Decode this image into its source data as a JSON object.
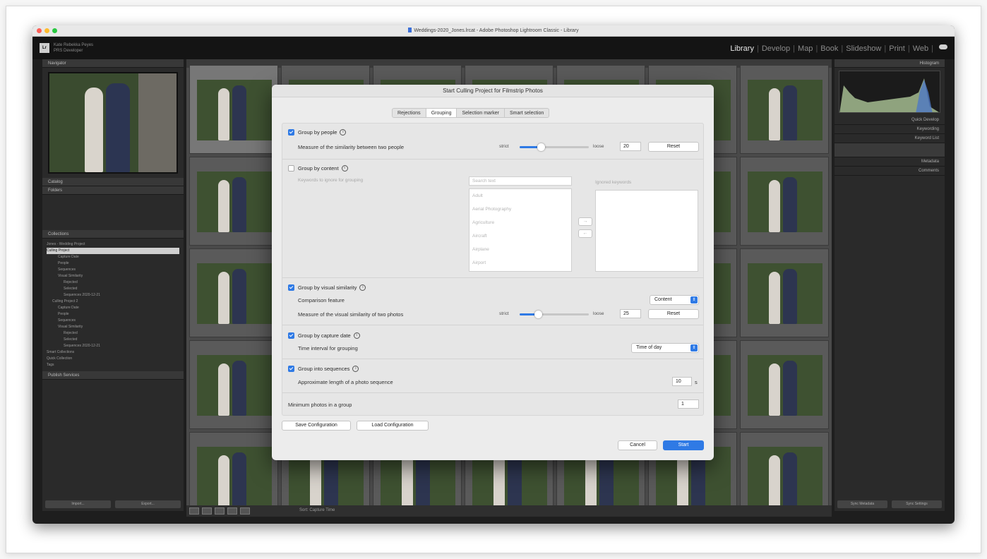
{
  "window": {
    "title": "Weddings-2020_Jones.lrcat - Adobe Photoshop Lightroom Classic - Library"
  },
  "identity": {
    "logo": "Lr",
    "line1": "Kate Rebekka Peyes",
    "line2": "PRS Developer"
  },
  "modules": [
    "Library",
    "Develop",
    "Map",
    "Book",
    "Slideshow",
    "Print",
    "Web"
  ],
  "active_module": "Library",
  "left_panel": {
    "navigator": "Navigator",
    "catalog": "Catalog",
    "folders": "Folders",
    "collections": "Collections",
    "publish": "Publish Services",
    "tree": [
      "Jones - Wedding Project",
      "Culling Project",
      "Capture Date",
      "People",
      "Sequences",
      "Visual Similarity",
      "Rejected",
      "Selected",
      "Sequences 2020-12-21",
      "Culling Project 2",
      "Capture Date",
      "People",
      "Sequences",
      "Visual Similarity",
      "Rejected",
      "Selected",
      "Sequences 2020-12-21",
      "Smart Collections",
      "Quick Collection",
      "Tags"
    ],
    "import_btn": "Import...",
    "export_btn": "Export..."
  },
  "right_panel": {
    "histogram": "Histogram",
    "quick_develop": "Quick Develop",
    "keywording": "Keywording",
    "keyword_list": "Keyword List",
    "metadata": "Metadata",
    "comments": "Comments",
    "sync_meta": "Sync Metadata",
    "sync_settings": "Sync Settings"
  },
  "toolbar": {
    "sort_label": "Sort: Capture Time"
  },
  "dialog": {
    "title": "Start Culling Project for Filmstrip Photos",
    "tabs": [
      "Rejections",
      "Grouping",
      "Selection marker",
      "Smart selection"
    ],
    "active_tab": "Grouping",
    "people": {
      "label": "Group by people",
      "desc": "Measure of the similarity between two people",
      "strict": "strict",
      "loose": "loose",
      "value": "20",
      "reset": "Reset"
    },
    "content": {
      "label": "Group by content",
      "desc": "Keywords to ignore for grouping",
      "search_placeholder": "Search text",
      "keywords": [
        "Adult",
        "Aerial Photography",
        "Agriculture",
        "Aircraft",
        "Airplane",
        "Airport"
      ],
      "ignored_label": "Ignored keywords",
      "add": "→",
      "remove": "←"
    },
    "visual": {
      "label": "Group by visual similarity",
      "feature_label": "Comparison feature",
      "feature_value": "Content",
      "desc": "Measure of the visual similarity of two photos",
      "strict": "strict",
      "loose": "loose",
      "value": "25",
      "reset": "Reset"
    },
    "capture": {
      "label": "Group by capture date",
      "desc": "Time interval for grouping",
      "value": "Time of day"
    },
    "sequences": {
      "label": "Group into sequences",
      "desc": "Approximate length of a photo sequence",
      "value": "10",
      "unit": "s"
    },
    "minimum": {
      "label": "Minimum photos in a group",
      "value": "1"
    },
    "save": "Save Configuration",
    "load": "Load Configuration",
    "cancel": "Cancel",
    "start": "Start"
  }
}
